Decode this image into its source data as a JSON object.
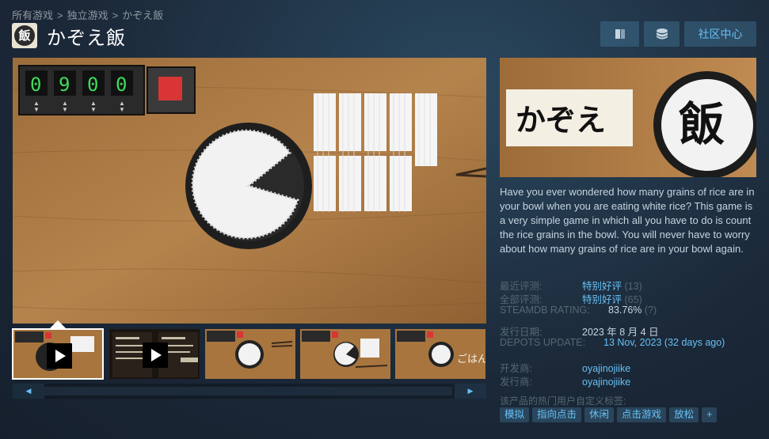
{
  "breadcrumb": {
    "items": [
      "所有游戏",
      "独立游戏",
      "かぞえ飯"
    ],
    "separator": ">"
  },
  "game": {
    "title": "かぞえ飯",
    "icon_char": "飯"
  },
  "header_buttons": {
    "ignore_icon": "ignore-icon",
    "follow_icon": "coins-icon",
    "community_label": "社区中心"
  },
  "main_screenshot": {
    "counter_digits": [
      "0",
      "9",
      "0",
      "0"
    ]
  },
  "capsule": {
    "title_kana": "かぞえ",
    "title_kanji": "飯"
  },
  "description": "Have you ever wondered how many grains of rice are in your bowl when you are eating white rice? This game is a very simple game in which all you have to do is count the rice grains in the bowl. You will never have to worry about how many grains of rice are in your bowl again.",
  "reviews": {
    "recent_label": "最近评测:",
    "recent_value": "特别好评",
    "recent_count": "(13)",
    "all_label": "全部评测:",
    "all_value": "特别好评",
    "all_count": "(65)",
    "steamdb_label": "STEAMDB RATING:",
    "steamdb_value": "83.76%",
    "steamdb_help": "(?)"
  },
  "release": {
    "label": "发行日期:",
    "value": "2023 年 8 月 4 日"
  },
  "depots": {
    "label": "DEPOTS UPDATE:",
    "value": "13 Nov, 2023 (32 days ago)"
  },
  "developer": {
    "label": "开发商:",
    "value": "oyajinojiike"
  },
  "publisher": {
    "label": "发行商:",
    "value": "oyajinojiike"
  },
  "tags_label": "该产品的热门用户自定义标签:",
  "tags": [
    "模拟",
    "指向点击",
    "休闲",
    "点击游戏",
    "放松",
    "+"
  ],
  "thumb_text": {
    "gohan": "ごはん"
  },
  "colors": {
    "bg": "#1b2838",
    "accent": "#67c1f5",
    "link": "#66c0f4",
    "muted": "#556772",
    "wood": "#a8753f",
    "counter_green": "#3ddc5a",
    "button_red": "#d93535"
  }
}
